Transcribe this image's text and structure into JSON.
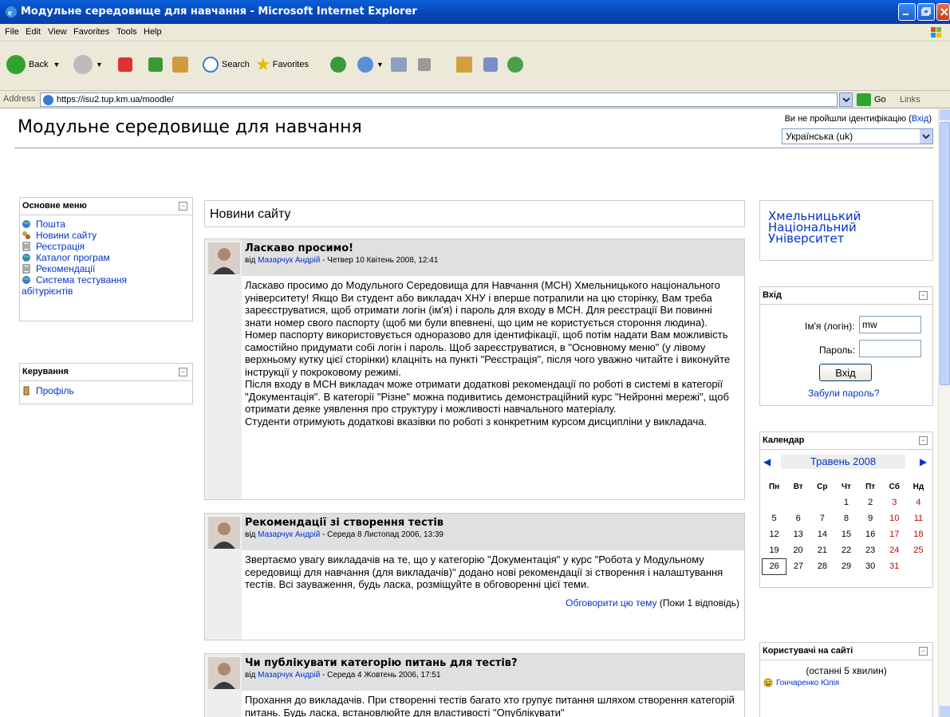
{
  "window": {
    "title": "Модульне середовище для навчання - Microsoft Internet Explorer"
  },
  "menubar": {
    "items": [
      "File",
      "Edit",
      "View",
      "Favorites",
      "Tools",
      "Help"
    ]
  },
  "toolbar": {
    "back": "Back",
    "search": "Search",
    "favorites": "Favorites"
  },
  "address": {
    "label": "Address",
    "url": "https://isu2.tup.km.ua/moodle/",
    "go": "Go",
    "links": "Links"
  },
  "header": {
    "site_title": "Модульне середовище для навчання",
    "login_text": "Ви не пройшли ідентифікацію (",
    "login_link": "Вхід",
    "login_close": ")",
    "language": "Українська (uk)"
  },
  "main_menu": {
    "title": "Основне меню",
    "items": [
      {
        "label": "Пошта",
        "icon": "globe-icon"
      },
      {
        "label": "Новини сайту",
        "icon": "forum-icon"
      },
      {
        "label": "Реєстрація",
        "icon": "page-icon"
      },
      {
        "label": "Каталог програм",
        "icon": "globe-icon"
      },
      {
        "label": "Рекомендації",
        "icon": "page-icon"
      },
      {
        "label": "Система тестування",
        "icon": "globe-icon"
      }
    ],
    "wrap_label": "абітурієнтів"
  },
  "admin_block": {
    "title": "Керування",
    "profile": "Профіль"
  },
  "news": {
    "heading": "Новини сайту",
    "by": "від ",
    "posts": [
      {
        "title": "Ласкаво просимо!",
        "author": "Мазарчук Андрій",
        "date": " - Четвер 10 Квітень 2008, 12:41",
        "body": "Ласкаво просимо до Модульного Середовища для Навчання (МСН) Хмельницького національного університету! Якщо Ви студент або викладач ХНУ і вперше потрапили на цю сторінку, Вам треба зареєструватися, щоб отримати логін (ім'я) і пароль для входу в МСН. Для реєстрації Ви повинні знати номер свого паспорту (щоб ми були впевнені, що цим не користується стороння людина). Номер паспорту використовується одноразово для ідентифікації, щоб потім надати Вам можливість самостійно придумати собі логін і пароль. Щоб зареєструватися, в \"Основному меню\" (у лівому верхньому кутку цієї сторінки) клацніть на пункті \"Реєстрація\", після чого уважно читайте і виконуйте інструкції у покроковому режимі.",
        "body2": "Після входу в МСН викладач може отримати додаткові рекомендації по роботі в системі в категорії \"Документація\". В категорії \"Різне\" можна подивитись демонстраційний курс \"Нейронні мережі\", щоб отримати деяке уявлення про структуру і можливості навчального матеріалу.",
        "body3": "Студенти отримують додаткові вказівки по роботі з конкретним курсом дисципліни у викладача."
      },
      {
        "title": "Рекомендації зі створення тестів",
        "author": "Мазарчук Андрій",
        "date": " - Середа 8 Листопад 2006, 13:39",
        "body": "Звертаємо увагу викладачів на те, що у категорію \"Документація\" у курс \"Робота у Модульному середовищі для навчання (для викладачів)\" додано нові рекомендації зі створення і налаштування тестів. Всі зауваження, будь ласка, розміщуйте в обговоренні цієї теми.",
        "discuss_link": "Обговорити цю тему",
        "discuss_count": " (Поки 1 відповідь)"
      },
      {
        "title": "Чи публікувати категорію питань для тестів?",
        "author": "Мазарчук Андрій",
        "date": " - Середа 4 Жовтень 2006, 17:51",
        "body": "Прохання до викладачів. При створенні тестів багато хто групує питання шляхом створення категорій питань. Будь ласка, встановлюйте для властивості \"Опублікувати\""
      }
    ]
  },
  "university": {
    "line1": "Хмельницький",
    "line2": "Національний",
    "line3": "Університет"
  },
  "login_block": {
    "title": "Вхід",
    "username_label": "Ім'я (логін):",
    "username_value": "mw",
    "password_label": "Пароль:",
    "submit": "Вхід",
    "forgot": "Забули пароль?"
  },
  "calendar": {
    "title": "Календар",
    "month": "Травень 2008",
    "days": [
      "Пн",
      "Вт",
      "Ср",
      "Чт",
      "Пт",
      "Сб",
      "Нд"
    ],
    "weeks": [
      [
        "",
        "",
        "",
        "1",
        "2",
        "3",
        "4"
      ],
      [
        "5",
        "6",
        "7",
        "8",
        "9",
        "10",
        "11"
      ],
      [
        "12",
        "13",
        "14",
        "15",
        "16",
        "17",
        "18"
      ],
      [
        "19",
        "20",
        "21",
        "22",
        "23",
        "24",
        "25"
      ],
      [
        "26",
        "27",
        "28",
        "29",
        "30",
        "31",
        ""
      ]
    ],
    "today": "26"
  },
  "online_users": {
    "title": "Користувачі на сайті",
    "period": "(останні 5 хвилин)",
    "user": "Гончаренко Юлія"
  },
  "colors": {
    "link": "#0033cc",
    "weekend": "#cc0000",
    "post_header": "#e0e0e0"
  }
}
